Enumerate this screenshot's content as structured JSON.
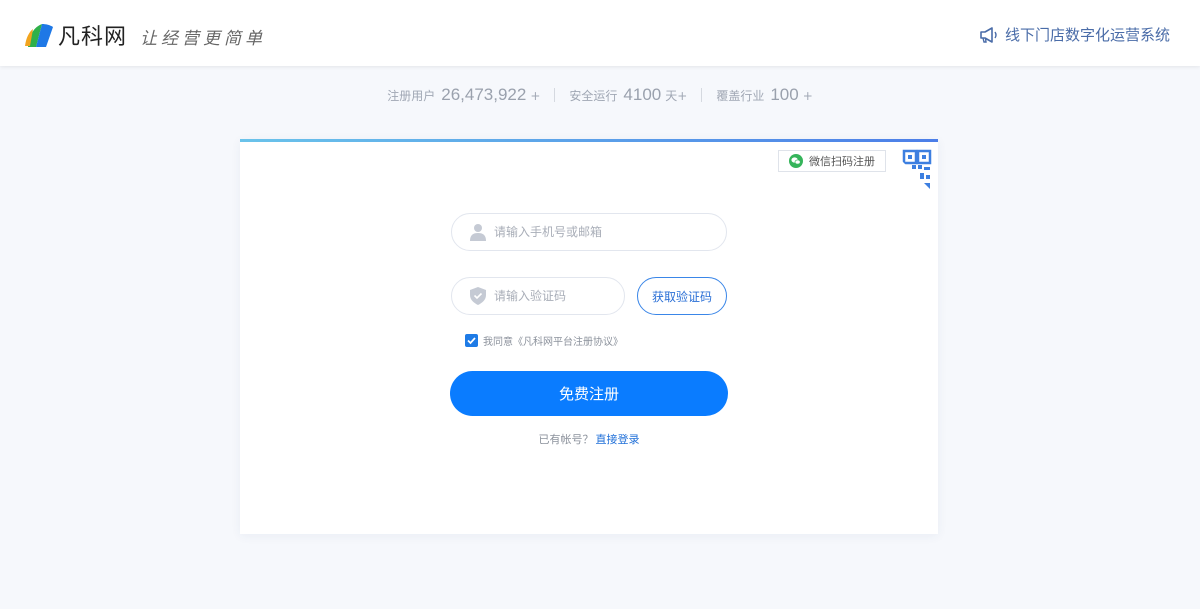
{
  "header": {
    "logo_name": "凡科网",
    "slogan": "让经营更简单",
    "right_link": "线下门店数字化运营系统",
    "icon": "megaphone-icon"
  },
  "stats": [
    {
      "label": "注册用户",
      "value": "26,473,922",
      "suffix": "+"
    },
    {
      "label": "安全运行",
      "value": "4100",
      "suffix": "天+"
    },
    {
      "label": "覆盖行业",
      "value": "100",
      "suffix": "+"
    }
  ],
  "form": {
    "qr_tip": "微信扫码注册",
    "phone_placeholder": "请输入手机号或邮箱",
    "code_placeholder": "请输入验证码",
    "get_code_label": "获取验证码",
    "agree_text": "我同意《凡科网平台注册协议》",
    "agree_checked": true,
    "submit_label": "免费注册",
    "has_account_text": "已有帐号？",
    "login_link": "直接登录"
  },
  "colors": {
    "primary": "#0a7cff",
    "link": "#1f6fd8",
    "background": "#f6f8fc",
    "wechat": "#35b45a"
  }
}
